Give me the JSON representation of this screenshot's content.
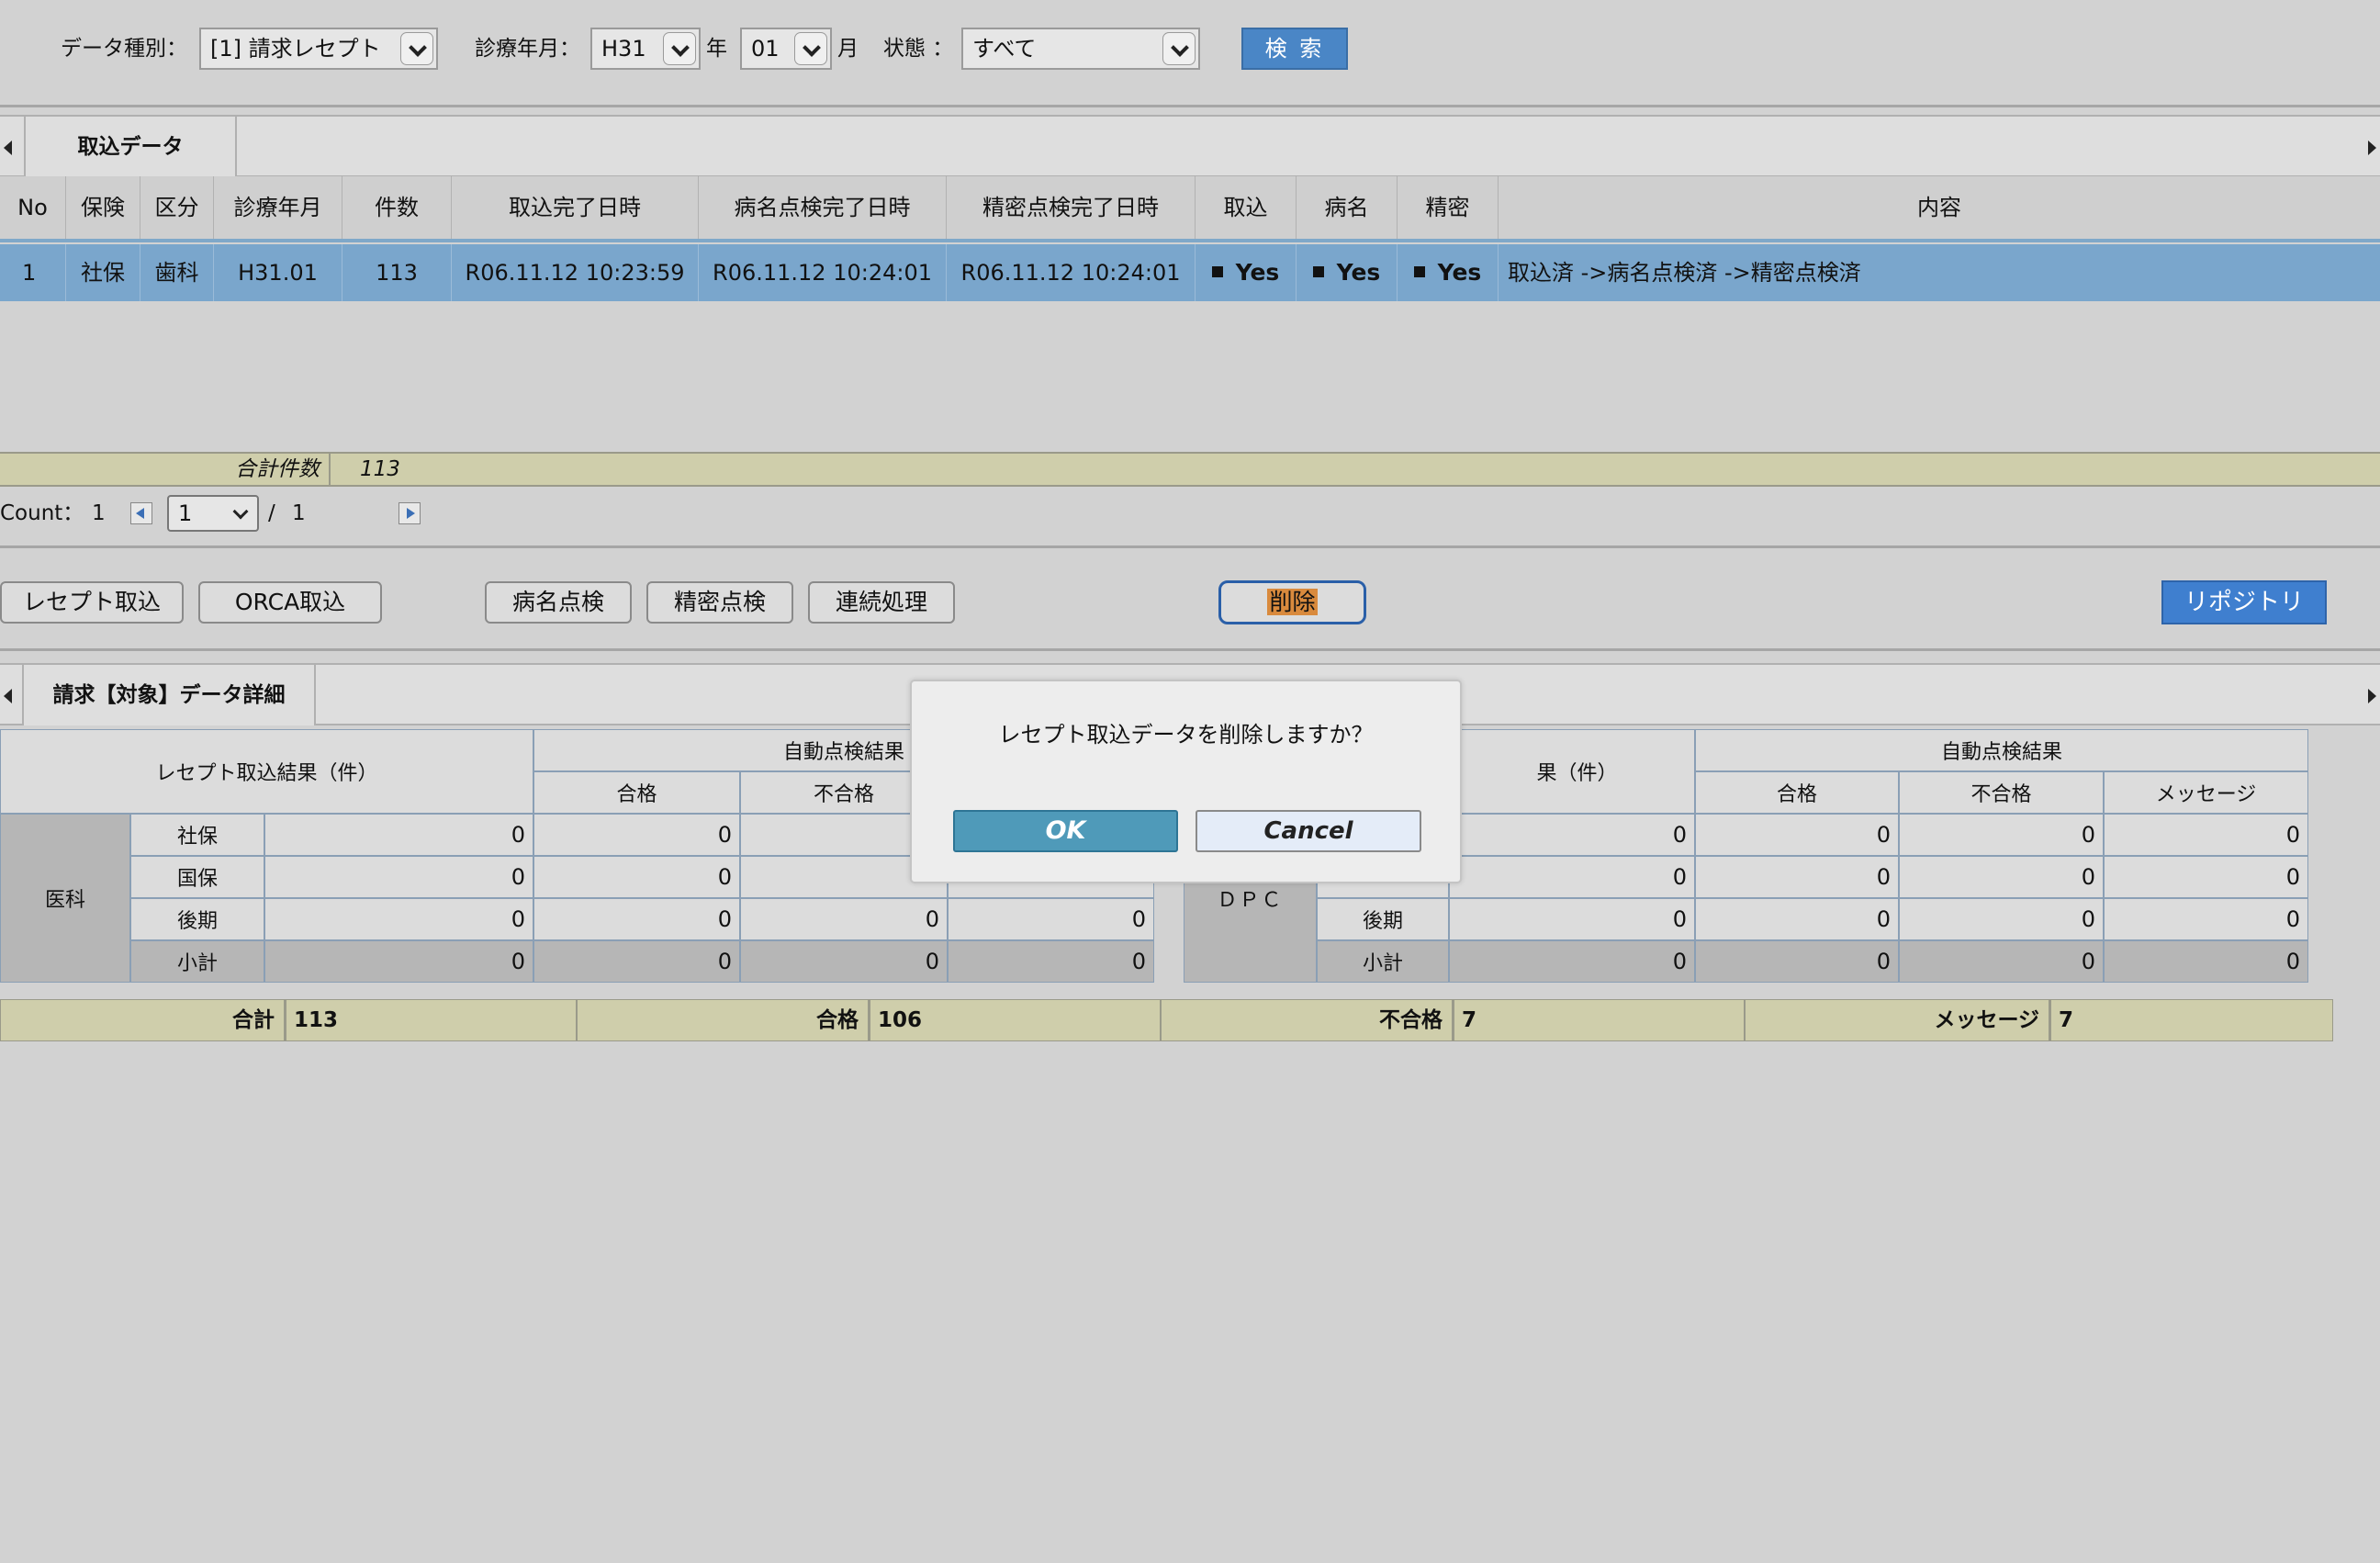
{
  "filter": {
    "data_type_label": "データ種別：",
    "data_type_value": "[1] 請求レセプト",
    "month_label": "診療年月：",
    "era_value": "H31",
    "year_suffix": "年",
    "month_value": "01",
    "month_suffix": "月",
    "status_label": "状態 ：",
    "status_value": "すべて",
    "search_button": "検 索"
  },
  "tabs": {
    "import_tab": "取込データ",
    "detail_tab": "請求【対象】データ詳細"
  },
  "table": {
    "headers": [
      "No",
      "保険",
      "区分",
      "診療年月",
      "件数",
      "取込完了日時",
      "病名点検完了日時",
      "精密点検完了日時",
      "取込",
      "病名",
      "精密",
      "内容"
    ],
    "rows": [
      {
        "no": "1",
        "insurance": "社保",
        "category": "歯科",
        "month": "H31.01",
        "count": "113",
        "import_done": "R06.11.12 10:23:59",
        "disease_done": "R06.11.12 10:24:01",
        "precise_done": "R06.11.12 10:24:01",
        "import_flag": "Yes",
        "disease_flag": "Yes",
        "precise_flag": "Yes",
        "content": "取込済 ->病名点検済 ->精密点検済"
      }
    ]
  },
  "summary": {
    "label": "合計件数",
    "value": "113"
  },
  "pager": {
    "count_label": "Count：",
    "count_value": "1",
    "page_value": "1",
    "slash": "/",
    "total_pages": "1"
  },
  "actions": {
    "receipt_import": "レセプト取込",
    "orca_import": "ORCA取込",
    "disease_check": "病名点検",
    "precise_check": "精密点検",
    "continuous": "連続処理",
    "delete": "削除",
    "repository": "リポジトリ"
  },
  "detail_left": {
    "import_result_header": "レセプト取込結果（件）",
    "auto_check_header": "自動点検結果",
    "pass_header": "合格",
    "fail_header": "不合格",
    "group_label": "医科",
    "rows": [
      {
        "label": "社保",
        "import": "0",
        "pass": "0",
        "fail": "",
        "msg": ""
      },
      {
        "label": "国保",
        "import": "0",
        "pass": "0",
        "fail": "",
        "msg": ""
      },
      {
        "label": "後期",
        "import": "0",
        "pass": "0",
        "fail": "0",
        "msg": "0"
      },
      {
        "label": "小計",
        "import": "0",
        "pass": "0",
        "fail": "0",
        "msg": "0"
      }
    ]
  },
  "detail_right": {
    "import_result_header_partial": "果（件）",
    "auto_check_header": "自動点検結果",
    "pass_header": "合格",
    "fail_header": "不合格",
    "message_header": "メッセージ",
    "group_label": "ＤＰＣ",
    "rows": [
      {
        "label": "",
        "import": "0",
        "pass": "0",
        "fail": "0",
        "msg": "0"
      },
      {
        "label": "",
        "import": "0",
        "pass": "0",
        "fail": "0",
        "msg": "0"
      },
      {
        "label": "後期",
        "import": "0",
        "pass": "0",
        "fail": "0",
        "msg": "0"
      },
      {
        "label": "小計",
        "import": "0",
        "pass": "0",
        "fail": "0",
        "msg": "0"
      }
    ]
  },
  "totals": {
    "total_label": "合計",
    "total_value": "113",
    "pass_label": "合格",
    "pass_value": "106",
    "fail_label": "不合格",
    "fail_value": "7",
    "message_label": "メッセージ",
    "message_value": "7"
  },
  "dialog": {
    "message": "レセプト取込データを削除しますか？",
    "ok": "OK",
    "cancel": "Cancel"
  },
  "colors": {
    "selected_row": "#7aa6cc",
    "summary_bg": "#cfceab",
    "search_button": "#4a86c6",
    "repository_button": "#3f7fcf",
    "ok_button": "#4f9ab9",
    "delete_highlight": "#d98a3d"
  }
}
